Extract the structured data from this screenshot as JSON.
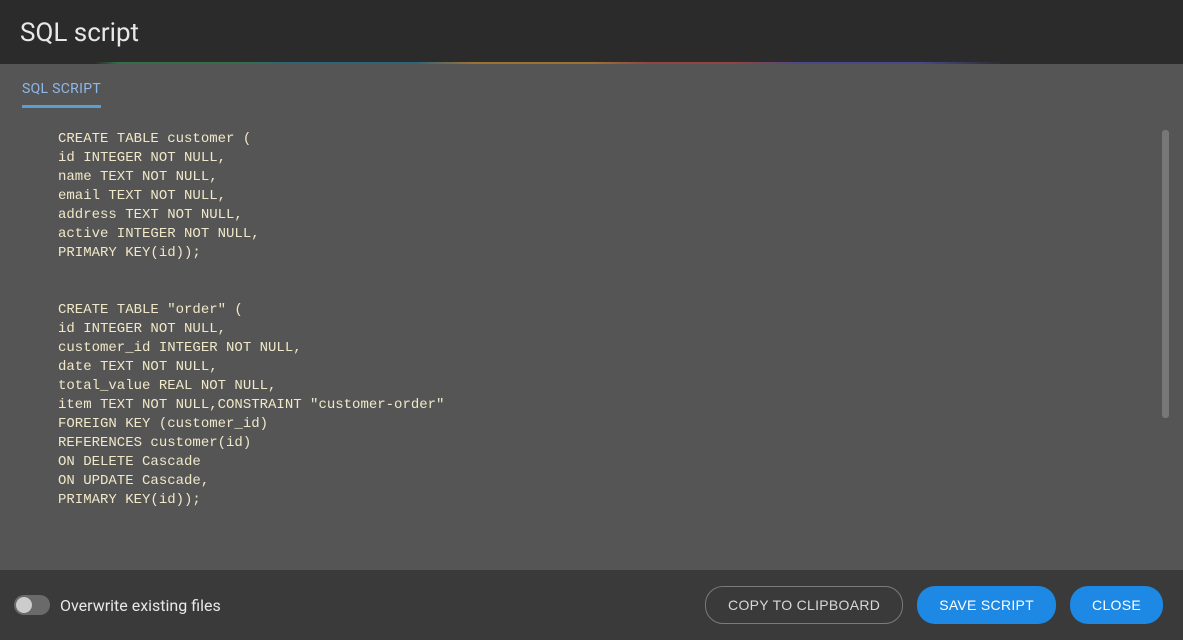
{
  "header": {
    "title": "SQL script"
  },
  "tabs": {
    "active": "SQL SCRIPT"
  },
  "script": {
    "lines": [
      "CREATE TABLE customer (",
      "id INTEGER NOT NULL,",
      "name TEXT NOT NULL,",
      "email TEXT NOT NULL,",
      "address TEXT NOT NULL,",
      "active INTEGER NOT NULL,",
      "PRIMARY KEY(id));",
      "",
      "",
      "CREATE TABLE \"order\" (",
      "id INTEGER NOT NULL,",
      "customer_id INTEGER NOT NULL,",
      "date TEXT NOT NULL,",
      "total_value REAL NOT NULL,",
      "item TEXT NOT NULL,CONSTRAINT \"customer-order\"",
      "FOREIGN KEY (customer_id)",
      "REFERENCES customer(id)",
      "ON DELETE Cascade",
      "ON UPDATE Cascade,",
      "PRIMARY KEY(id));"
    ]
  },
  "footer": {
    "toggle_label": "Overwrite existing files",
    "copy_label": "COPY TO CLIPBOARD",
    "save_label": "SAVE SCRIPT",
    "close_label": "CLOSE"
  }
}
